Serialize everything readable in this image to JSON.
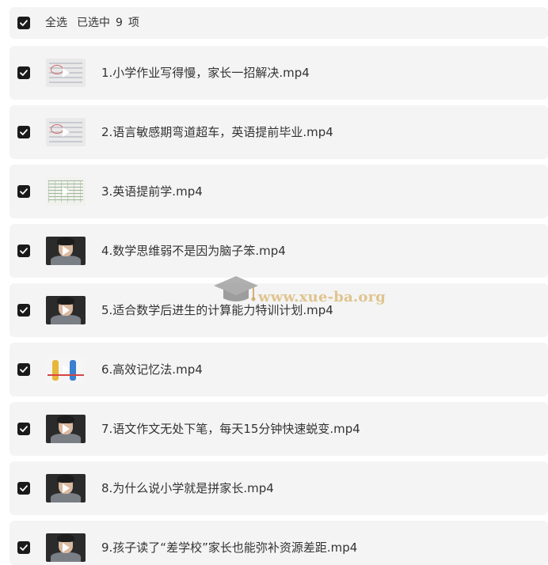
{
  "header": {
    "select_all_label": "全选",
    "selected_prefix": "已选中",
    "selected_count": "9",
    "selected_suffix": "项",
    "checked": true
  },
  "items": [
    {
      "title": "1.小学作业写得慢，家长一招解决.mp4",
      "checked": true,
      "thumbnail": "document"
    },
    {
      "title": "2.语言敏感期弯道超车，英语提前毕业.mp4",
      "checked": true,
      "thumbnail": "document"
    },
    {
      "title": "3.英语提前学.mp4",
      "checked": true,
      "thumbnail": "table"
    },
    {
      "title": "4.数学思维弱不是因为脑子笨.mp4",
      "checked": true,
      "thumbnail": "person"
    },
    {
      "title": "5.适合数学后进生的计算能力特训计划.mp4",
      "checked": true,
      "thumbnail": "person"
    },
    {
      "title": "6.高效记忆法.mp4",
      "checked": true,
      "thumbnail": "cartoon"
    },
    {
      "title": "7.语文作文无处下笔，每天15分钟快速蜕变.mp4",
      "checked": true,
      "thumbnail": "person"
    },
    {
      "title": "8.为什么说小学就是拼家长.mp4",
      "checked": true,
      "thumbnail": "person"
    },
    {
      "title": "9.孩子读了“差学校”家长也能弥补资源差距.mp4",
      "checked": true,
      "thumbnail": "person"
    }
  ],
  "watermark": {
    "text": "www.xue-ba.org",
    "icon": "graduation-cap-icon"
  },
  "colors": {
    "row_background": "#f4f4f4",
    "checkbox_fill": "#1a1a1a",
    "text": "#333333",
    "watermark": "#dab46e"
  }
}
